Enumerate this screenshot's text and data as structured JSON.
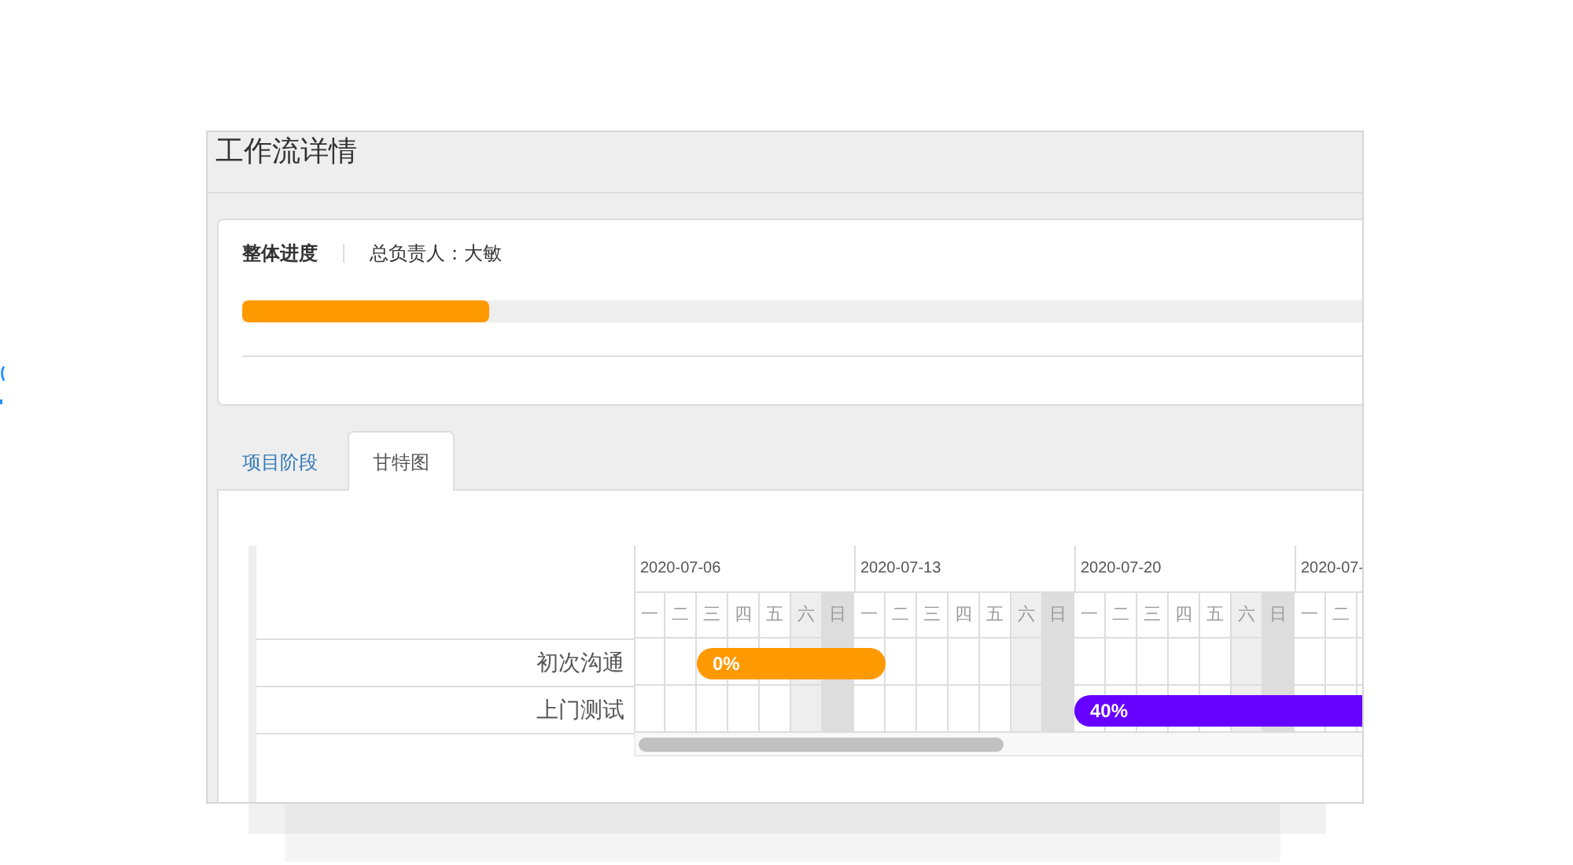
{
  "window": {
    "title": "工作流详情"
  },
  "overview": {
    "label": "整体进度",
    "owner": "总负责人：大敏",
    "level": 0.22
  },
  "tabs": [
    {
      "label": "项目阶段",
      "selected": false
    },
    {
      "label": "甘特图",
      "selected": true
    }
  ],
  "gantt": {
    "weeks": [
      {
        "date": "2020-07-06",
        "days": [
          {
            "label": "一",
            "kind": "workday"
          },
          {
            "label": "二",
            "kind": "workday"
          },
          {
            "label": "三",
            "kind": "workday"
          },
          {
            "label": "四",
            "kind": "workday"
          },
          {
            "label": "五",
            "kind": "workday"
          },
          {
            "label": "六",
            "kind": "saturday"
          },
          {
            "label": "日",
            "kind": "sunday"
          }
        ]
      },
      {
        "date": "2020-07-13",
        "days": [
          {
            "label": "一",
            "kind": "workday"
          },
          {
            "label": "二",
            "kind": "workday"
          },
          {
            "label": "三",
            "kind": "workday"
          },
          {
            "label": "四",
            "kind": "workday"
          },
          {
            "label": "五",
            "kind": "workday"
          },
          {
            "label": "六",
            "kind": "saturday"
          },
          {
            "label": "日",
            "kind": "sunday"
          }
        ]
      },
      {
        "date": "2020-07-20",
        "days": [
          {
            "label": "一",
            "kind": "workday"
          },
          {
            "label": "二",
            "kind": "workday"
          },
          {
            "label": "三",
            "kind": "workday"
          },
          {
            "label": "四",
            "kind": "workday"
          },
          {
            "label": "五",
            "kind": "workday"
          },
          {
            "label": "六",
            "kind": "saturday"
          },
          {
            "label": "日",
            "kind": "sunday"
          }
        ]
      },
      {
        "date": "2020-07-",
        "days": [
          {
            "label": "一",
            "kind": "workday"
          },
          {
            "label": "二",
            "kind": "workday"
          }
        ]
      }
    ],
    "tasks": [
      {
        "name": "初次沟通",
        "progress": "0%",
        "color": "#ff9900"
      },
      {
        "name": "上门测试",
        "progress": "40%",
        "color": "#6600ff"
      }
    ]
  }
}
